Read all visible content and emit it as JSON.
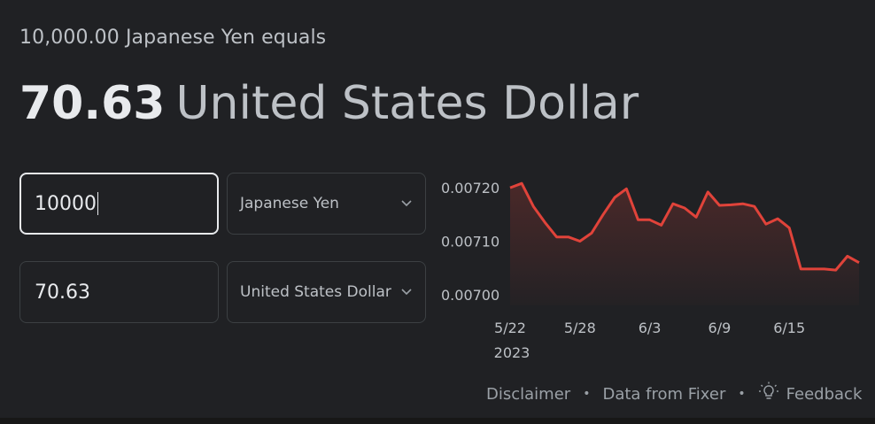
{
  "conversion": {
    "summary": "10,000.00 Japanese Yen equals",
    "result_amount": "70.63",
    "result_currency": "United States Dollar"
  },
  "inputs": {
    "from_amount": "10000",
    "to_amount": "70.63",
    "from_currency": "Japanese Yen",
    "to_currency": "United States Dollar"
  },
  "footer": {
    "disclaimer": "Disclaimer",
    "data_source": "Data from Fixer",
    "feedback": "Feedback",
    "separator": "•"
  },
  "icons": {
    "dropdown": "chevron-down-icon",
    "feedback": "lightbulb-icon"
  },
  "colors": {
    "line": "#e0433a",
    "background": "#202124"
  },
  "chart_data": {
    "type": "area",
    "x": [
      "2023-05-22",
      "2023-05-23",
      "2023-05-24",
      "2023-05-25",
      "2023-05-26",
      "2023-05-27",
      "2023-05-28",
      "2023-05-29",
      "2023-05-30",
      "2023-05-31",
      "2023-06-01",
      "2023-06-02",
      "2023-06-03",
      "2023-06-04",
      "2023-06-05",
      "2023-06-06",
      "2023-06-07",
      "2023-06-08",
      "2023-06-09",
      "2023-06-10",
      "2023-06-11",
      "2023-06-12",
      "2023-06-13",
      "2023-06-14",
      "2023-06-15",
      "2023-06-16",
      "2023-06-17",
      "2023-06-18",
      "2023-06-19",
      "2023-06-20",
      "2023-06-21"
    ],
    "values": [
      0.0072,
      0.007208,
      0.007165,
      0.007135,
      0.007108,
      0.007108,
      0.0071,
      0.007115,
      0.00715,
      0.007182,
      0.007198,
      0.00714,
      0.00714,
      0.00713,
      0.00717,
      0.007162,
      0.007145,
      0.007192,
      0.007167,
      0.007168,
      0.00717,
      0.007165,
      0.007132,
      0.007142,
      0.007125,
      0.007048,
      0.007048,
      0.007048,
      0.007046,
      0.007072,
      0.00706
    ],
    "x_tick_labels": [
      "5/22",
      "5/28",
      "6/3",
      "6/9",
      "6/15"
    ],
    "x_year_label": "2023",
    "y_tick_labels": [
      "0.00720",
      "0.00710",
      "0.00700"
    ],
    "ylim": [
      0.00698,
      0.00722
    ],
    "grid": false,
    "legend": "none"
  }
}
